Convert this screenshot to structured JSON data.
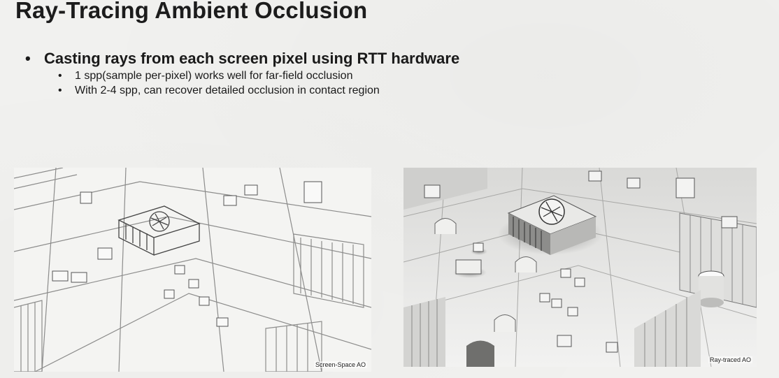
{
  "slide": {
    "title": "Ray-Tracing Ambient Occlusion",
    "bullets": {
      "main": "Casting rays from each screen pixel using RTT hardware",
      "sub": [
        "1 spp(sample per-pixel) works well for far-field occlusion",
        "With 2-4 spp, can recover detailed occlusion in contact region"
      ]
    },
    "bullet_glyph": "•"
  },
  "images": {
    "left_caption": "Screen-Space AO",
    "right_caption": "Ray-traced AO"
  },
  "colors": {
    "background": "#f1f1ef",
    "text": "#1a1a1a"
  }
}
